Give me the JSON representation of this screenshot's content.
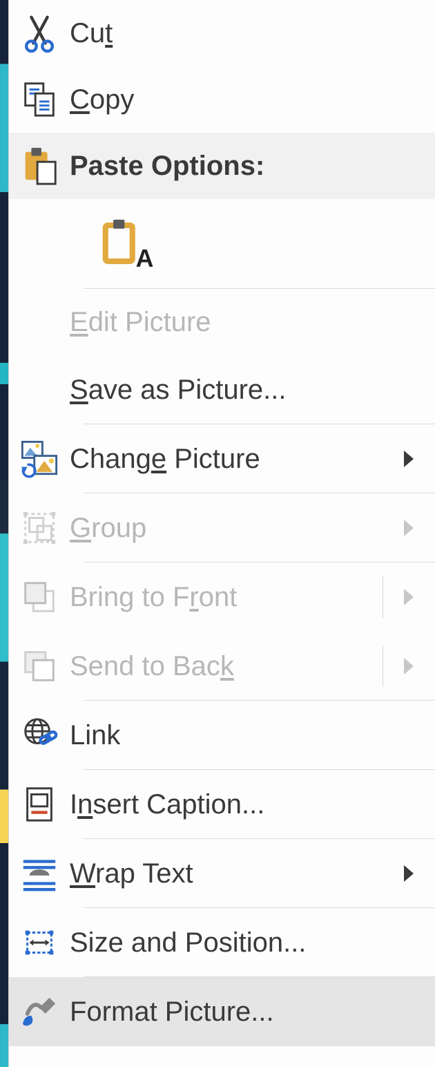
{
  "menu": {
    "cut": {
      "pre": "Cu",
      "u": "t",
      "post": ""
    },
    "copy": {
      "pre": "",
      "u": "C",
      "post": "opy"
    },
    "paste_options_label": "Paste Options:",
    "edit_picture": {
      "pre": "",
      "u": "E",
      "post": "dit Picture"
    },
    "save_as_picture": {
      "pre": "",
      "u": "S",
      "post": "ave as Picture..."
    },
    "change_picture": {
      "pre": "Chang",
      "u": "e",
      "post": " Picture"
    },
    "group": {
      "pre": "",
      "u": "G",
      "post": "roup"
    },
    "bring_front": {
      "pre": "Bring to F",
      "u": "r",
      "post": "ont"
    },
    "send_back": {
      "pre": "Send to Bac",
      "u": "k",
      "post": ""
    },
    "link": "Link",
    "insert_caption": {
      "pre": "I",
      "u": "n",
      "post": "sert Caption..."
    },
    "wrap_text": {
      "pre": "",
      "u": "W",
      "post": "rap Text"
    },
    "size_position": "Size and Position...",
    "format_picture": "Format Picture..."
  }
}
